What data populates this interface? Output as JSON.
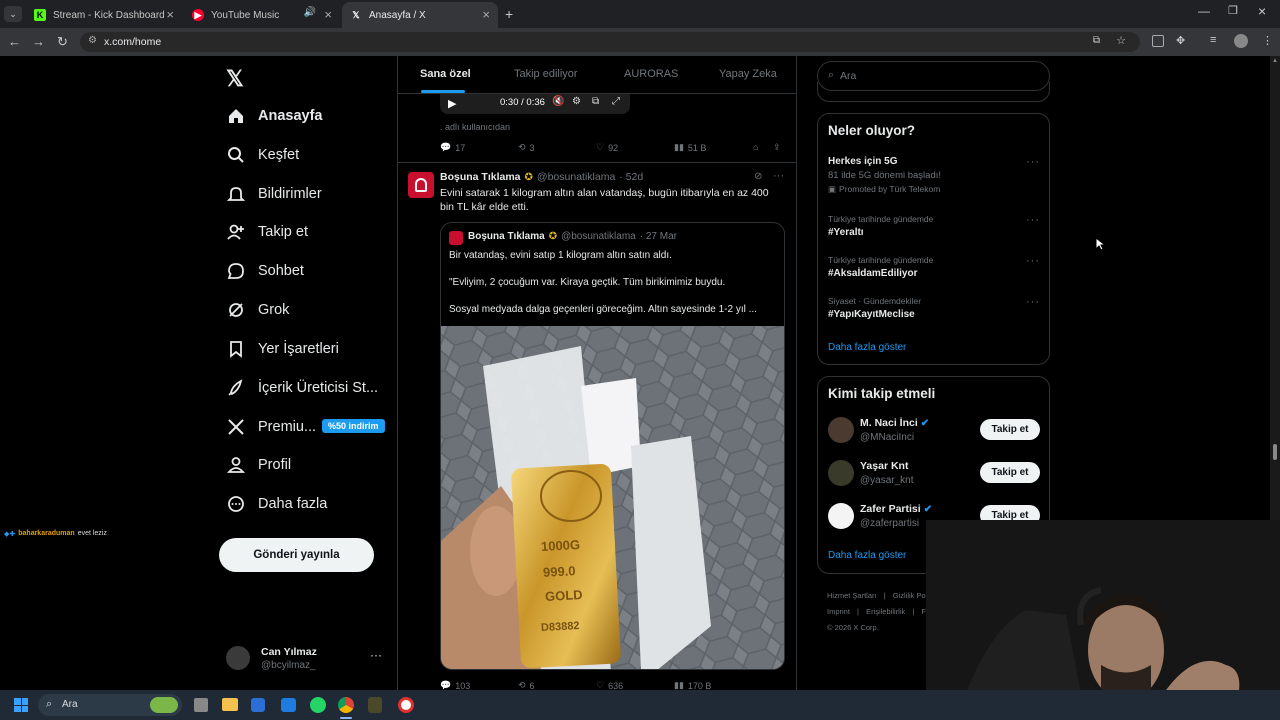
{
  "browser": {
    "tabs": [
      {
        "title": "Stream - Kick Dashboard",
        "icon": "kick-icon"
      },
      {
        "title": "YouTube Music",
        "icon": "youtube-music-icon"
      },
      {
        "title": "Anasayfa / X",
        "icon": "x-icon"
      }
    ],
    "url": "x.com/home"
  },
  "nav": {
    "items": [
      {
        "label": "Anasayfa",
        "icon": "home-icon"
      },
      {
        "label": "Keşfet",
        "icon": "search-icon"
      },
      {
        "label": "Bildirimler",
        "icon": "bell-icon"
      },
      {
        "label": "Takip et",
        "icon": "follow-icon"
      },
      {
        "label": "Sohbet",
        "icon": "chat-icon"
      },
      {
        "label": "Grok",
        "icon": "grok-icon"
      },
      {
        "label": "Yer İşaretleri",
        "icon": "bookmark-icon"
      },
      {
        "label": "İçerik Üreticisi St...",
        "icon": "rocket-icon"
      },
      {
        "label": "Premiu...",
        "icon": "x-icon"
      },
      {
        "label": "Profil",
        "icon": "profile-icon"
      },
      {
        "label": "Daha fazla",
        "icon": "more-icon"
      }
    ],
    "premium_badge": "%50 indirim",
    "post_button": "Gönderi yayınla",
    "user": {
      "name": "Can Yılmaz",
      "handle": "@bcyilmaz_"
    }
  },
  "chat_overlay": {
    "user": "baharkaraduman",
    "message": "evet leziz"
  },
  "feed": {
    "tabs": [
      "Sana özel",
      "Takip ediliyor",
      "AURORAS",
      "Yapay Zeka"
    ],
    "prev_tweet": {
      "player_time": "0:30 / 0:36",
      "note": ". adlı kullanıcıdan",
      "replies": "17",
      "retweets": "3",
      "likes": "92",
      "views": "51 B"
    },
    "tweet": {
      "name": "Boşuna Tıklama",
      "handle": "@bosunatiklama",
      "time": "· 52d",
      "text": "Evini satarak 1 kilogram altın alan vatandaş, bugün itibarıyla en az 400 bin TL kâr elde etti.",
      "quote": {
        "name": "Boşuna Tıklama",
        "handle": "@bosunatiklama",
        "time": "· 27 Mar",
        "line1": "Bir vatandaş, evini satıp 1 kilogram altın satın aldı.",
        "line2": "\"Evliyim, 2 çocuğum var. Kiraya geçtik. Tüm birikimimiz buydu.",
        "line3": "Sosyal medyada dalga geçenleri göreceğim. Altın sayesinde 1-2 yıl ..."
      },
      "gold_text": [
        "1000G",
        "999.0",
        "GOLD",
        "D83882"
      ],
      "replies": "103",
      "retweets": "6",
      "likes": "636",
      "views": "170 B"
    }
  },
  "right": {
    "search_placeholder": "Ara",
    "trends_title": "Neler oluyor?",
    "trends": [
      {
        "context": "",
        "title": "Herkes için 5G",
        "sub": "81 ilde 5G dönemi başladı!",
        "promo": "Promoted by Türk Telekom"
      },
      {
        "context": "Türkiye tarihinde gündemde",
        "title": "#Yeraltı"
      },
      {
        "context": "Türkiye tarihinde gündemde",
        "title": "#AksaİdamEdiliyor"
      },
      {
        "context": "Siyaset · Gündemdekiler",
        "title": "#YapıKayıtMeclise"
      }
    ],
    "show_more": "Daha fazla göster",
    "who_title": "Kimi takip etmeli",
    "who": [
      {
        "name": "M. Naci İnci",
        "handle": "@MNaciInci",
        "verified": true
      },
      {
        "name": "Yaşar Knt",
        "handle": "@yasar_knt",
        "verified": false
      },
      {
        "name": "Zafer Partisi",
        "handle": "@zaferpartisi",
        "verified": true
      }
    ],
    "follow_label": "Takip et",
    "show_more2": "Daha fazla göster",
    "footer": [
      "Hizmet Şartları",
      "Gizlilik Po",
      "Imprint",
      "Erişilebilirlik",
      "F",
      "© 2026 X Corp."
    ]
  },
  "taskbar": {
    "search": "Ara"
  },
  "colors": {
    "accent": "#1d9bf0",
    "gold": "#d4a93a",
    "badge": "#1d9bf0"
  }
}
